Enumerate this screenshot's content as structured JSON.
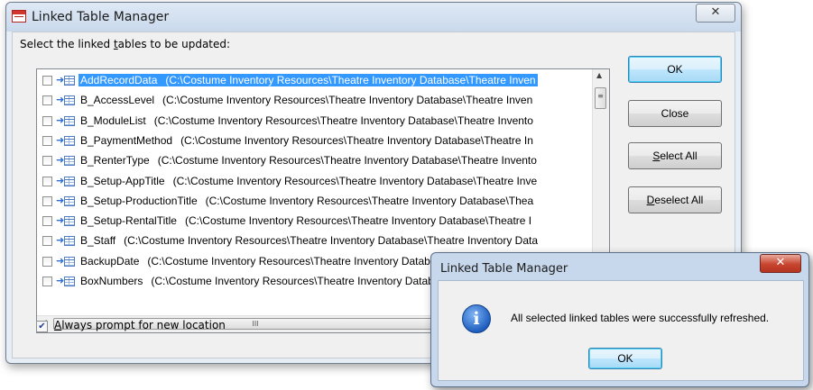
{
  "main_window": {
    "title": "Linked Table Manager",
    "close_label": "✕",
    "prompt_label": "Select the linked tables to be updated:",
    "tables": [
      {
        "name": "AddRecordData",
        "path": "(C:\\Costume Inventory Resources\\Theatre Inventory Database\\Theatre Inven",
        "checked": false,
        "selected": true
      },
      {
        "name": "B_AccessLevel",
        "path": "(C:\\Costume Inventory Resources\\Theatre Inventory Database\\Theatre Inven",
        "checked": false,
        "selected": false
      },
      {
        "name": "B_ModuleList",
        "path": "(C:\\Costume Inventory Resources\\Theatre Inventory Database\\Theatre Invento",
        "checked": false,
        "selected": false
      },
      {
        "name": "B_PaymentMethod",
        "path": "(C:\\Costume Inventory Resources\\Theatre Inventory Database\\Theatre In",
        "checked": false,
        "selected": false
      },
      {
        "name": "B_RenterType",
        "path": "(C:\\Costume Inventory Resources\\Theatre Inventory Database\\Theatre Invento",
        "checked": false,
        "selected": false
      },
      {
        "name": "B_Setup-AppTitle",
        "path": "(C:\\Costume Inventory Resources\\Theatre Inventory Database\\Theatre Inve",
        "checked": false,
        "selected": false
      },
      {
        "name": "B_Setup-ProductionTitle",
        "path": "(C:\\Costume Inventory Resources\\Theatre Inventory Database\\Thea",
        "checked": false,
        "selected": false
      },
      {
        "name": "B_Setup-RentalTitle",
        "path": "(C:\\Costume Inventory Resources\\Theatre Inventory Database\\Theatre I",
        "checked": false,
        "selected": false
      },
      {
        "name": "B_Staff",
        "path": "(C:\\Costume Inventory Resources\\Theatre Inventory Database\\Theatre Inventory Data",
        "checked": false,
        "selected": false
      },
      {
        "name": "BackupDate",
        "path": "(C:\\Costume Inventory Resources\\Theatre Inventory Database\\Theatre Invento",
        "checked": false,
        "selected": false
      },
      {
        "name": "BoxNumbers",
        "path": "(C:\\Costume Inventory Resources\\Theatre Inventory Database\\Theatre Invento",
        "checked": false,
        "selected": false
      }
    ],
    "buttons": {
      "ok": "OK",
      "close": "Close",
      "select_all": {
        "pre": "",
        "accel": "S",
        "post": "elect All"
      },
      "deselect_all": {
        "pre": "",
        "accel": "D",
        "post": "eselect All"
      }
    },
    "always_prompt": {
      "checked": true,
      "accel": "A",
      "rest": "lways prompt for new location"
    },
    "scroll_grip": "III",
    "scroll_up": "▲",
    "scroll_left": "◄"
  },
  "message_box": {
    "title": "Linked Table Manager",
    "close_label": "✕",
    "icon_glyph": "i",
    "message": "All selected linked tables were successfully refreshed.",
    "ok_label": "OK"
  }
}
